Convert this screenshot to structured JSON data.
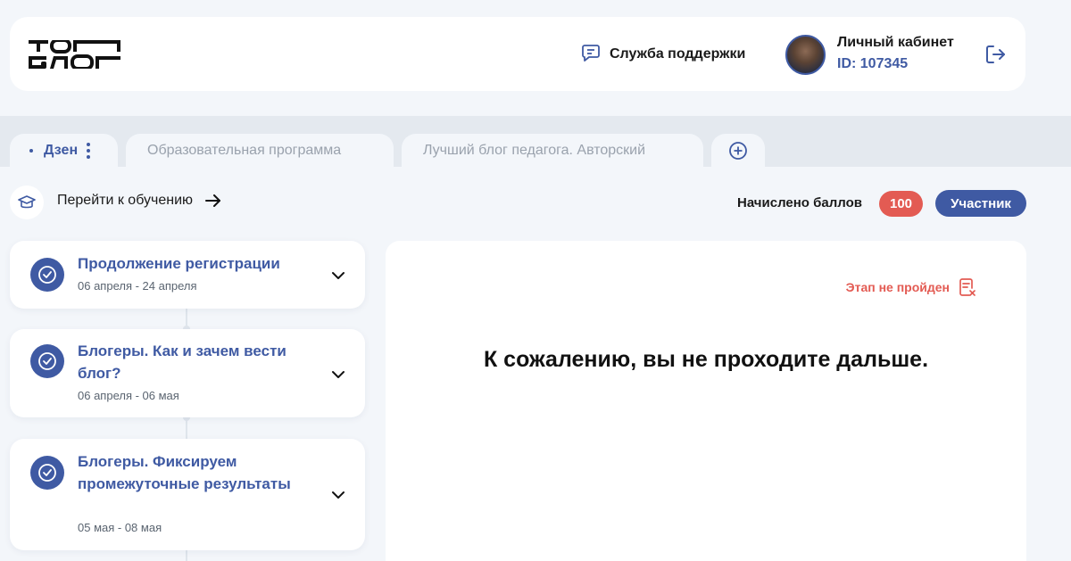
{
  "header": {
    "logo_text": "ТОП БЛОГ",
    "support_label": "Служба поддержки",
    "cabinet_title": "Личный кабинет",
    "cabinet_id": "ID: 107345"
  },
  "tabs": [
    {
      "label": "Дзен",
      "active": true
    },
    {
      "label": "Образовательная программа",
      "active": false
    },
    {
      "label": "Лучший блог педагога. Авторский",
      "active": false
    }
  ],
  "learning": {
    "link_label": "Перейти к обучению"
  },
  "points": {
    "label": "Начислено баллов",
    "value": "100"
  },
  "role": {
    "label": "Участник"
  },
  "stages": [
    {
      "title": "Продолжение регистрации",
      "dates": "06 апреля - 24 апреля"
    },
    {
      "title": "Блогеры. Как и зачем вести блог?",
      "dates": "06 апреля - 06 мая"
    },
    {
      "title": "Блогеры. Фиксируем промежуточные результаты",
      "dates": "05 мая - 08 мая"
    }
  ],
  "panel": {
    "status_label": "Этап не пройден",
    "message": "К сожалению, вы не проходите дальше."
  },
  "colors": {
    "brand": "#3f5aa3",
    "danger": "#e35b53",
    "background": "#f3f6fa"
  },
  "icons": [
    "chat-icon",
    "logout-icon",
    "plus-circle-icon",
    "graduation-cap-icon",
    "arrow-right-icon",
    "check-circle-icon",
    "chevron-down-icon",
    "document-x-icon",
    "kebab-menu-icon"
  ]
}
